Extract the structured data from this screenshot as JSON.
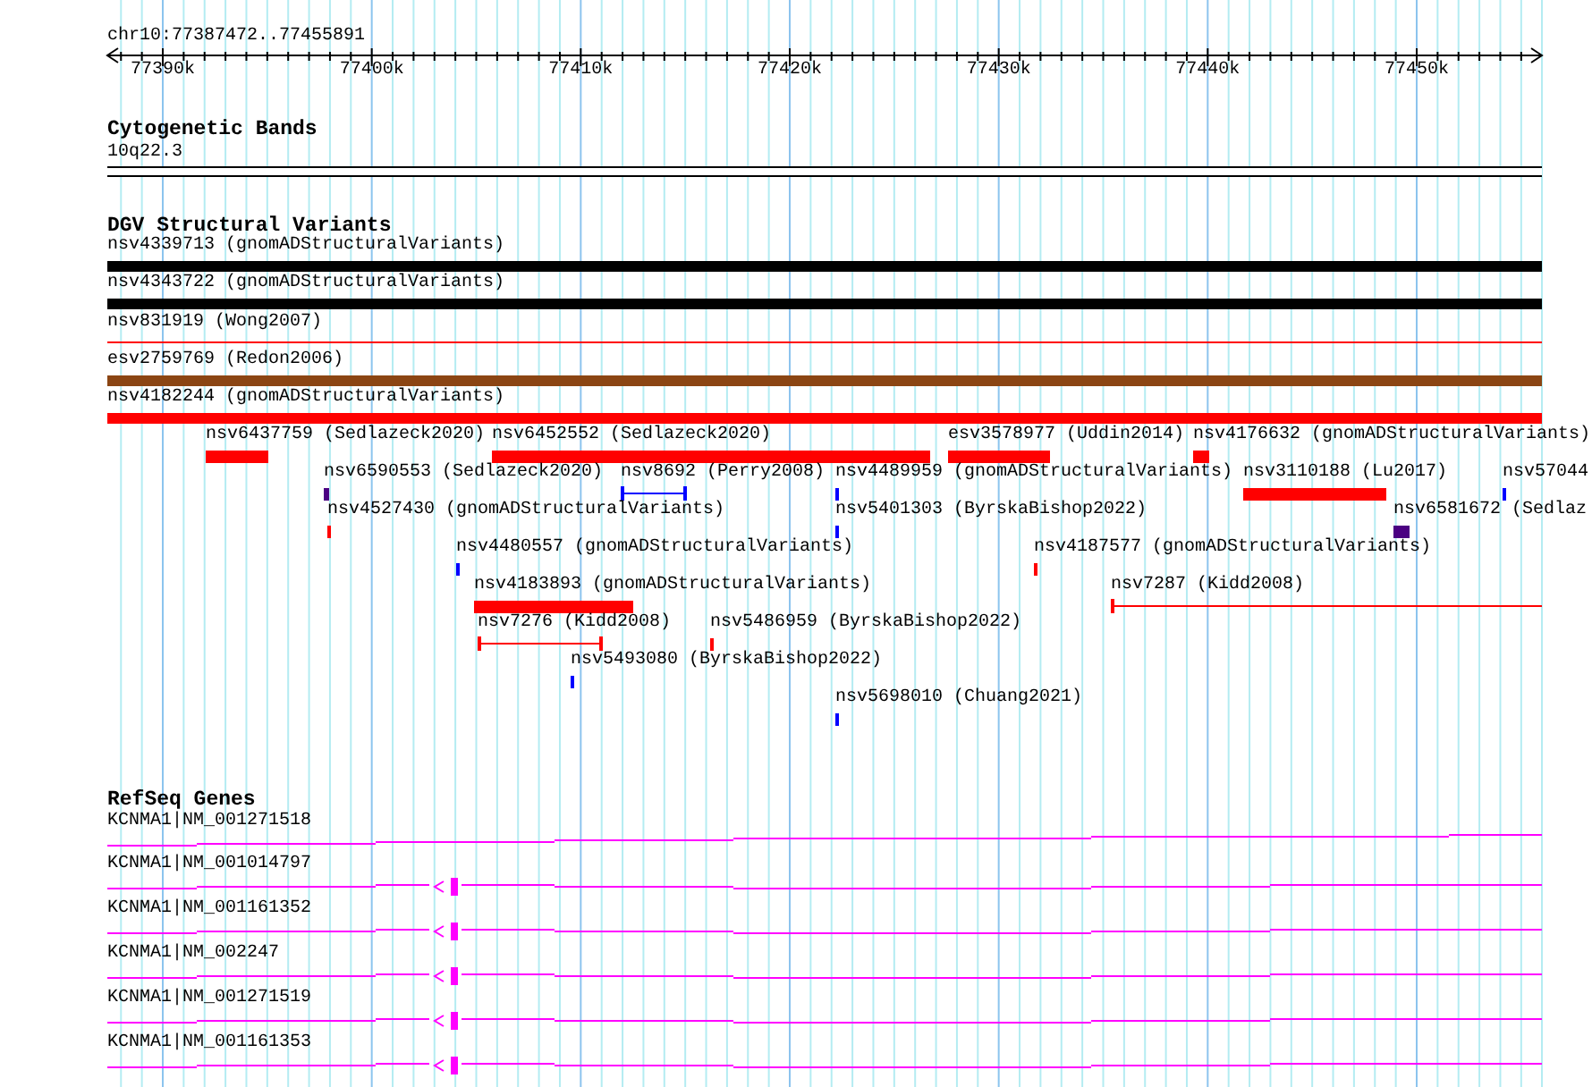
{
  "location": "chr10:77387472..77455891",
  "ruler": {
    "ticks": [
      "77390k",
      "77400k",
      "77410k",
      "77420k",
      "77430k",
      "77440k",
      "77450k"
    ]
  },
  "cytogenetic_bands": {
    "title": "Cytogenetic Bands",
    "bands": [
      {
        "name": "10q22.3"
      }
    ]
  },
  "dgv": {
    "title": "DGV Structural Variants",
    "variants": [
      {
        "label": "nsv4339713 (gnomADStructuralVariants)",
        "kind": "bar",
        "color": "#000000"
      },
      {
        "label": "nsv4343722 (gnomADStructuralVariants)",
        "kind": "bar",
        "color": "#000000"
      },
      {
        "label": "nsv831919 (Wong2007)",
        "kind": "line",
        "color": "#ff0000"
      },
      {
        "label": "esv2759769 (Redon2006)",
        "kind": "bar",
        "color": "#8b4513"
      },
      {
        "label": "nsv4182244 (gnomADStructuralVariants)",
        "kind": "bar",
        "color": "#ff0000"
      },
      {
        "label": "nsv6437759 (Sedlazeck2020)",
        "kind": "bar",
        "color": "#ff0000"
      },
      {
        "label": "nsv6452552 (Sedlazeck2020)",
        "kind": "bar",
        "color": "#ff0000"
      },
      {
        "label": "esv3578977 (Uddin2014)",
        "kind": "bar",
        "color": "#ff0000"
      },
      {
        "label": "nsv4176632 (gnomADStructuralVariants)",
        "kind": "bar",
        "color": "#ff0000"
      },
      {
        "label": "nsv6590553 (Sedlazeck2020)",
        "kind": "bar",
        "color": "#4b0082"
      },
      {
        "label": "nsv8692 (Perry2008)",
        "kind": "range",
        "color": "#0000ff"
      },
      {
        "label": "nsv4489959 (gnomADStructuralVariants)",
        "kind": "bar",
        "color": "#0000ff"
      },
      {
        "label": "nsv3110188 (Lu2017)",
        "kind": "bar",
        "color": "#ff0000"
      },
      {
        "label": "nsv57044",
        "kind": "bar",
        "color": "#0000ff"
      },
      {
        "label": "nsv4527430 (gnomADStructuralVariants)",
        "kind": "bar",
        "color": "#ff0000"
      },
      {
        "label": "nsv5401303 (ByrskaBishop2022)",
        "kind": "bar",
        "color": "#0000ff"
      },
      {
        "label": "nsv6581672 (Sedlaz",
        "kind": "bar",
        "color": "#4b0082"
      },
      {
        "label": "nsv4480557 (gnomADStructuralVariants)",
        "kind": "bar",
        "color": "#0000ff"
      },
      {
        "label": "nsv4187577 (gnomADStructuralVariants)",
        "kind": "bar",
        "color": "#ff0000"
      },
      {
        "label": "nsv4183893 (gnomADStructuralVariants)",
        "kind": "bar",
        "color": "#ff0000"
      },
      {
        "label": "nsv7287 (Kidd2008)",
        "kind": "range",
        "color": "#ff0000"
      },
      {
        "label": "nsv7276 (Kidd2008)",
        "kind": "range",
        "color": "#ff0000"
      },
      {
        "label": "nsv5486959 (ByrskaBishop2022)",
        "kind": "bar",
        "color": "#ff0000"
      },
      {
        "label": "nsv5493080 (ByrskaBishop2022)",
        "kind": "bar",
        "color": "#0000ff"
      },
      {
        "label": "nsv5698010 (Chuang2021)",
        "kind": "bar",
        "color": "#0000ff"
      }
    ]
  },
  "refseq": {
    "title": "RefSeq Genes",
    "genes": [
      {
        "label": "KCNMA1|NM_001271518"
      },
      {
        "label": "KCNMA1|NM_001014797"
      },
      {
        "label": "KCNMA1|NM_001161352"
      },
      {
        "label": "KCNMA1|NM_002247"
      },
      {
        "label": "KCNMA1|NM_001271519"
      },
      {
        "label": "KCNMA1|NM_001161353"
      }
    ]
  }
}
